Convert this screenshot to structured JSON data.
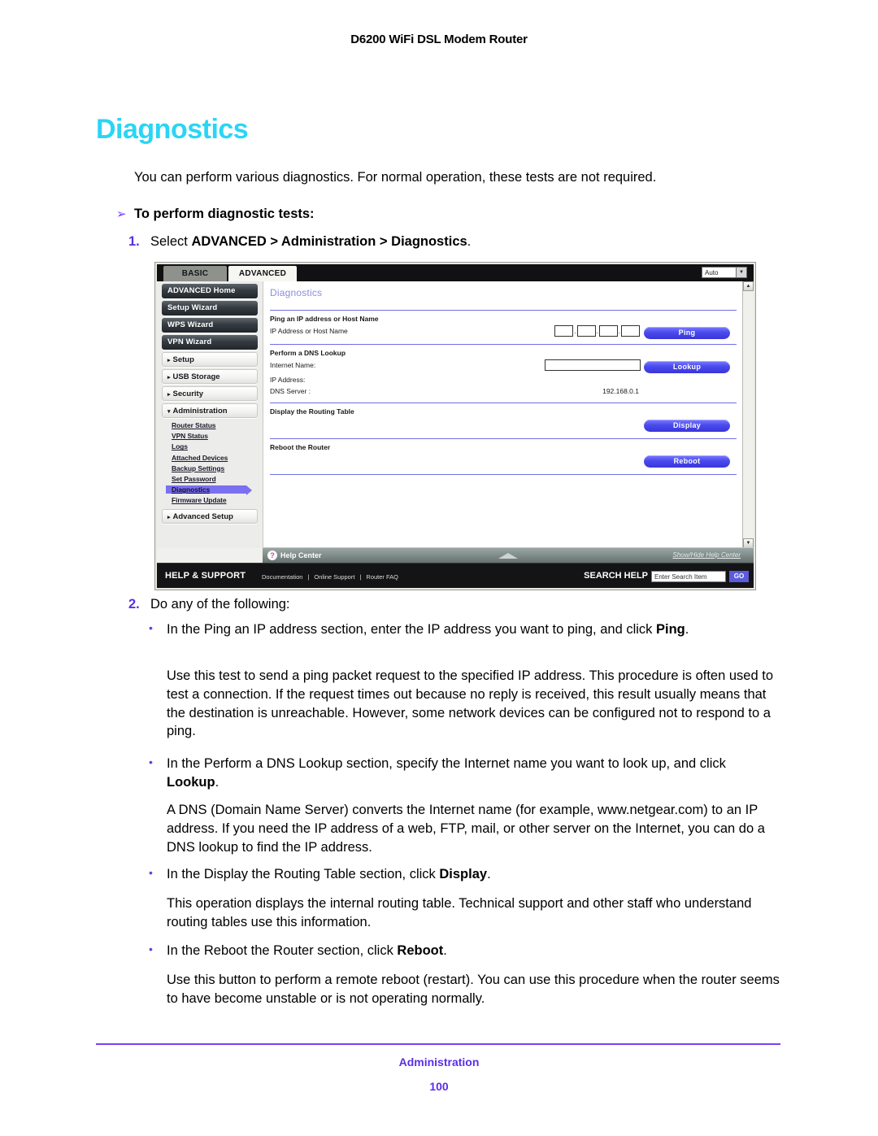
{
  "page_header": "D6200 WiFi DSL Modem Router",
  "chapter_title": "Diagnostics",
  "intro": "You can perform various diagnostics. For normal operation, these tests are not required.",
  "procedure_heading": "To perform diagnostic tests:",
  "procedure_arrow": "➢",
  "step1": {
    "number": "1.",
    "text_prefix": "Select ",
    "text_bold": "ADVANCED > Administration > Diagnostics",
    "text_suffix": "."
  },
  "step2": {
    "number": "2.",
    "text": "Do any of the following:"
  },
  "bullets": [
    {
      "marker": "•",
      "lead_prefix": "In the Ping an IP address section, enter the IP address you want to ping, and click ",
      "lead_bold": "Ping",
      "lead_suffix": ".",
      "body": "Use this test to send a ping packet request to the specified IP address. This procedure is often used to test a connection. If the request times out because no reply is received, this result usually means that the destination is unreachable. However, some network devices can be configured not to respond to a ping."
    },
    {
      "marker": "•",
      "lead_prefix": "In the Perform a DNS Lookup section, specify the Internet name you want to look up, and click ",
      "lead_bold": "Lookup",
      "lead_suffix": ".",
      "body": "A DNS (Domain Name Server) converts the Internet name (for example, www.netgear.com) to an IP address. If you need the IP address of a web, FTP, mail, or other server on the Internet, you can do a DNS lookup to find the IP address."
    },
    {
      "marker": "•",
      "lead_prefix": "In the Display the Routing Table section, click ",
      "lead_bold": "Display",
      "lead_suffix": ".",
      "body": "This operation displays the internal routing table. Technical support and other staff who understand routing tables use this information."
    },
    {
      "marker": "•",
      "lead_prefix": "In the Reboot the Router section, click ",
      "lead_bold": "Reboot",
      "lead_suffix": ".",
      "body": "Use this button to perform a remote reboot (restart). You can use this procedure when the router seems to have become unstable or is not operating normally."
    }
  ],
  "footer": {
    "section": "Administration",
    "page_number": "100"
  },
  "router_ui": {
    "tabs": {
      "basic": "BASIC",
      "advanced": "ADVANCED"
    },
    "language_select": {
      "value": "Auto",
      "caret": "▼"
    },
    "sidebar": {
      "buttons": [
        "ADVANCED Home",
        "Setup Wizard",
        "WPS Wizard",
        "VPN Wizard"
      ],
      "sections": [
        {
          "label": "Setup",
          "caret": "▸"
        },
        {
          "label": "USB Storage",
          "caret": "▸"
        },
        {
          "label": "Security",
          "caret": "▸"
        },
        {
          "label": "Administration",
          "caret": "▾"
        }
      ],
      "admin_items": [
        "Router Status",
        "VPN Status",
        "Logs",
        "Attached Devices",
        "Backup Settings",
        "Set Password",
        "Diagnostics",
        "Firmware Update"
      ],
      "active_item": "Diagnostics",
      "advanced_setup": {
        "label": "Advanced Setup",
        "caret": "▸"
      }
    },
    "pane_title": "Diagnostics",
    "sections": {
      "ping": {
        "heading": "Ping an IP address or Host Name",
        "field_label": "IP Address or Host Name",
        "octets": [
          "",
          "",
          "",
          ""
        ],
        "separator": ".",
        "button": "Ping"
      },
      "dns": {
        "heading": "Perform a DNS Lookup",
        "internet_name_label": "Internet Name:",
        "internet_name_value": "",
        "ip_address_label": "IP Address:",
        "ip_address_value": "",
        "dns_server_label": "DNS Server :",
        "dns_server_value": "192.168.0.1",
        "button": "Lookup"
      },
      "routing": {
        "heading": "Display the Routing Table",
        "button": "Display"
      },
      "reboot": {
        "heading": "Reboot the Router",
        "button": "Reboot"
      }
    },
    "help_center": {
      "icon": "?",
      "label": "Help Center",
      "toggle_link": "Show/Hide Help Center"
    },
    "bottom_bar": {
      "title": "HELP & SUPPORT",
      "links": [
        "Documentation",
        "Online Support",
        "Router FAQ"
      ],
      "separator": "|",
      "search_title": "SEARCH HELP",
      "search_placeholder": "Enter Search Item",
      "go_button": "GO"
    },
    "scroll": {
      "up": "▲",
      "down": "▼",
      "left": "◄",
      "right": "►"
    }
  }
}
